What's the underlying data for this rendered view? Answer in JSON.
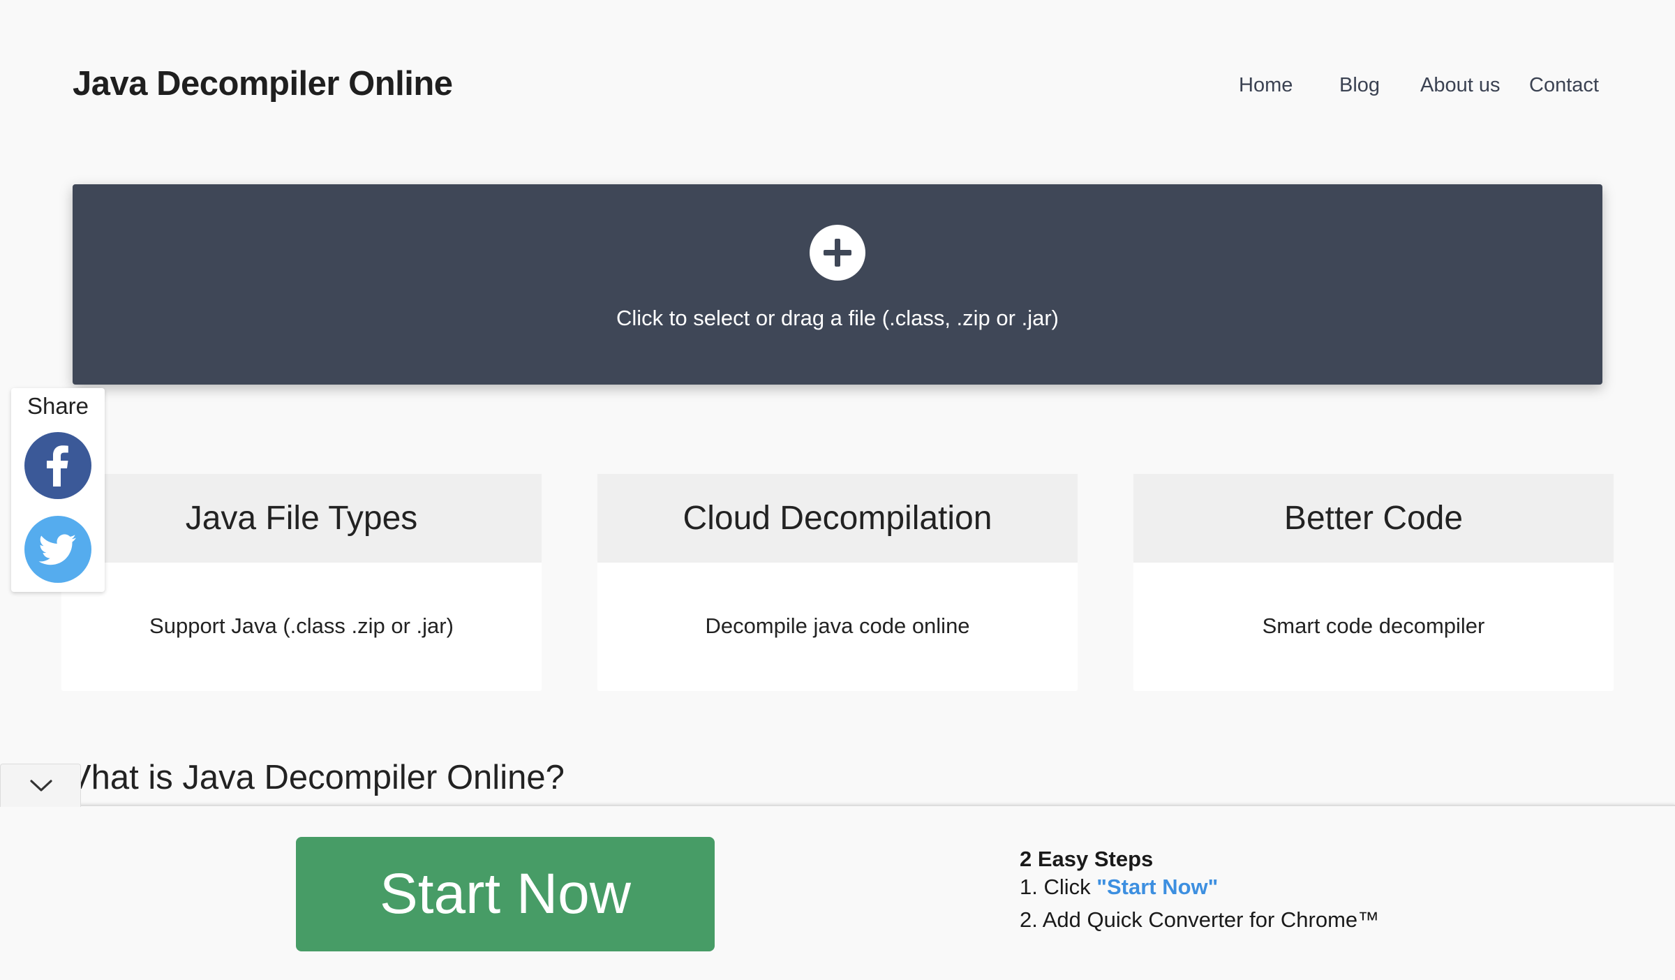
{
  "header": {
    "site_title": "Java Decompiler Online",
    "nav": [
      "Home",
      "Blog",
      "About us",
      "Contact"
    ]
  },
  "upload": {
    "icon": "plus-circle-icon",
    "text": "Click to select or drag a file (.class, .zip or .jar)"
  },
  "share": {
    "label": "Share",
    "networks": [
      "facebook",
      "twitter"
    ]
  },
  "features": [
    {
      "title": "Java File Types",
      "text": "Support Java (.class .zip or .jar)"
    },
    {
      "title": "Cloud Decompilation",
      "text": "Decompile java code online"
    },
    {
      "title": "Better Code",
      "text": "Smart code decompiler"
    }
  ],
  "section": {
    "heading": "Vhat is Java Decompiler Online?"
  },
  "bottom_bar": {
    "button": "Start Now",
    "steps_title": "2 Easy Steps",
    "step1_prefix": "1. Click ",
    "step1_link": "\"Start Now\"",
    "step2": "2. Add Quick Converter for Chrome™"
  },
  "colors": {
    "upload_bg": "#3f4757",
    "start_button": "#479c66",
    "facebook": "#3b5998",
    "twitter": "#55acee",
    "step_highlight": "#3d8fe0"
  }
}
